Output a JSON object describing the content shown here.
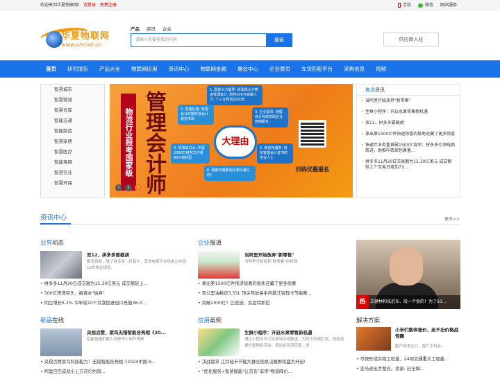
{
  "topbar": {
    "welcome": "欢迎来到华夏物联网！",
    "login": "请登录",
    "register": "免费注册",
    "phone": "手机",
    "wechat": "微信",
    "services": "网站服务"
  },
  "logo": {
    "cn": "华夏物联网",
    "en": "www.chniot.cn"
  },
  "search": {
    "tabs": [
      "产品",
      "资讯",
      "企业"
    ],
    "placeholder": "请输入你要查找的内容",
    "button": "搜索"
  },
  "supplier_button": "供应商入驻",
  "nav": [
    "首页",
    "研究报告",
    "产品大全",
    "物联网应用",
    "资讯中心",
    "物联网金融",
    "展会中心",
    "企业黄页",
    "车货匹配平台",
    "采购信息",
    "视频"
  ],
  "sidebar": [
    "智慧城市",
    "智慧物流",
    "智慧仓库",
    "智能交通",
    "智能制造",
    "智慧家居",
    "智慧医疗",
    "智能电网",
    "智慧农业",
    "智慧环保"
  ],
  "banner": {
    "tag": "物流行业报考国家级",
    "big": "管理会计师",
    "b1": "1. 国家大力倡导: 财政部大力推进管理会计, 培养300万高端人才; 十三五规划2020年",
    "b2": "2. 发展机遇: 管理会计时期开放会计服务市场",
    "b3": "3. 企业需求: 管理会计有效协助企业控制额负",
    "b4": "4. 市场缺口大: 中国2000万财务工作者95%将转型",
    "b5": "5. 薪资待遇高: 持有管理会计证书的专业人士",
    "b6": "6. 政策初期都是好考好通过的!",
    "center": "大理由",
    "qr_label": "扫码优惠报名",
    "dots": [
      "1",
      "2",
      "3"
    ]
  },
  "focus": {
    "title_a": "焦点",
    "title_b": "资讯",
    "items": [
      "当阿里开始放弃\"新零售\"",
      "生鲜小程序：开启水果零售新机遇",
      "双12，拼多多要截胡",
      "拿出第1500亿件快递惊喜的极免还藏了更多惊喜",
      "快递年业务量首破1500亿背后：拼多多引领电商西进，助推中西部包裹量...",
      "拼多多11月20日交易额为15.30亿美元 成交额较上个交易日增加73..."
    ]
  },
  "section": {
    "title": "资讯中心",
    "more": "更多>>"
  },
  "industry": {
    "title_a": "业界",
    "title_b": "动态",
    "headline": "双12，拼多多要截胡",
    "desc": "截至目前，除了拼多多：抖音外，其他电商平台尚未公布双12的相关规划。",
    "items": [
      "拼多多11月20日成交额为15.30亿美元 成交额较上...",
      "500亿快递巨头，被资本\"抛弃\"",
      "同比增长5.2% 今年前10个月我国进出口总值36.0..."
    ]
  },
  "enterprise": {
    "title_a": "企业",
    "title_b": "报道",
    "headline": "当阿里开始放弃\"新零售\"",
    "desc": "当阿里开始放弃\"新零售\"的终局",
    "items": [
      "拿出第1500亿件快递惊喜的极免还藏了更多惊喜",
      "百公里油耗仅3.55L 顶尖驾驶高手问鼎江铃轻卡节能赛...",
      "突破2000亿！比亚迪，反超特斯拉"
    ]
  },
  "feature": {
    "hot": "热",
    "caption": "王健林和张近东、段一个会的！为了50..."
  },
  "newproduct": {
    "title_a": "新品",
    "title_b": "在线",
    "headline": "央视点赞，菜鸟无错智能合亮相《20...",
    "desc": "智能快递机器人获获不少用户青睐",
    "items": [
      "央视点赞菜鸟科技能力！无错智能合亮相《2024中国·A...",
      "阿里巴巴成就小上万次亿约同..."
    ]
  },
  "application": {
    "title_a": "应用",
    "title_b": "案例",
    "headline": "生鲜小程序：开启水果零售新机遇",
    "desc": "通过小程序可以实现到店或配送，为线下店铺引流，增加消费的复购和活动。增加会员活跃度、进...",
    "items": [
      "决战需求 江铃轻卡节能大赛全国总决赛即将盛大开启!",
      "\"优化服务+智慧赋能\"让京东\"非常\"物流降价..."
    ]
  },
  "solution": {
    "title": "解决方案",
    "headline": "小米们集体涨价，走不出价格战怪圈",
    "desc": "国产成本压力，国产手机品...",
    "items": [
      "尽快形成实物工程量，24项交通重大工程建...",
      "亚马逊出手整合。卖家: 已全网..."
    ]
  }
}
